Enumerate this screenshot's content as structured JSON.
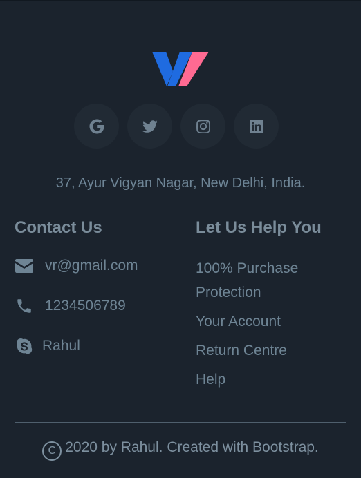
{
  "brand": {
    "logo_icon": "brand-v-logo",
    "colors": {
      "blue": "#1f6be0",
      "pink": "#ff6a92"
    }
  },
  "social": [
    {
      "name": "google",
      "icon": "google-icon"
    },
    {
      "name": "twitter",
      "icon": "twitter-icon"
    },
    {
      "name": "instagram",
      "icon": "instagram-icon"
    },
    {
      "name": "linkedin",
      "icon": "linkedin-icon"
    }
  ],
  "address": "37, Ayur Vigyan Nagar, New Delhi, India.",
  "contact": {
    "title": "Contact Us",
    "email": "vr@gmail.com",
    "phone": "1234506789",
    "skype": "Rahul"
  },
  "help": {
    "title": "Let Us Help You",
    "links": [
      "100% Purchase Protection",
      "Your Account",
      "Return Centre",
      "Help"
    ]
  },
  "copyright": {
    "symbol": "C",
    "text": "2020 by Rahul. Created with Bootstrap."
  }
}
